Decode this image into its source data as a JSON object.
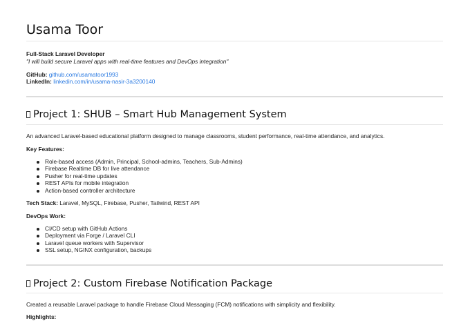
{
  "header": {
    "name": "Usama Toor",
    "role": "Full-Stack Laravel Developer",
    "tagline": "\"I will build secure Laravel apps with real-time features and DevOps integration\"",
    "github_label": "GitHub:",
    "github_link": "github.com/usamatoor1993",
    "linkedin_label": "LinkedIn:",
    "linkedin_link": "linkedin.com/in/usama-nasir-3a3200140"
  },
  "project1": {
    "title": "Project 1: SHUB – Smart Hub Management System",
    "description": "An advanced Laravel-based educational platform designed to manage classrooms, student performance, real-time attendance, and analytics.",
    "features_label": "Key Features:",
    "features": [
      "Role-based access (Admin, Principal, School-admins, Teachers, Sub-Admins)",
      "Firebase Realtime DB for live attendance",
      "Pusher for real-time updates",
      "REST APIs for mobile integration",
      "Action-based controller architecture"
    ],
    "tech_label": "Tech Stack:",
    "tech_value": "Laravel, MySQL, Firebase, Pusher, Tailwind, REST API",
    "devops_label": "DevOps Work:",
    "devops": [
      "CI/CD setup with GitHub Actions",
      "Deployment via Forge / Laravel CLI",
      "Laravel queue workers with Supervisor",
      "SSL setup, NGINX configuration, backups"
    ]
  },
  "project2": {
    "title": "Project 2: Custom Firebase Notification Package",
    "description": "Created a reusable Laravel package to handle Firebase Cloud Messaging (FCM) notifications with simplicity and flexibility.",
    "highlights_label": "Highlights:"
  }
}
